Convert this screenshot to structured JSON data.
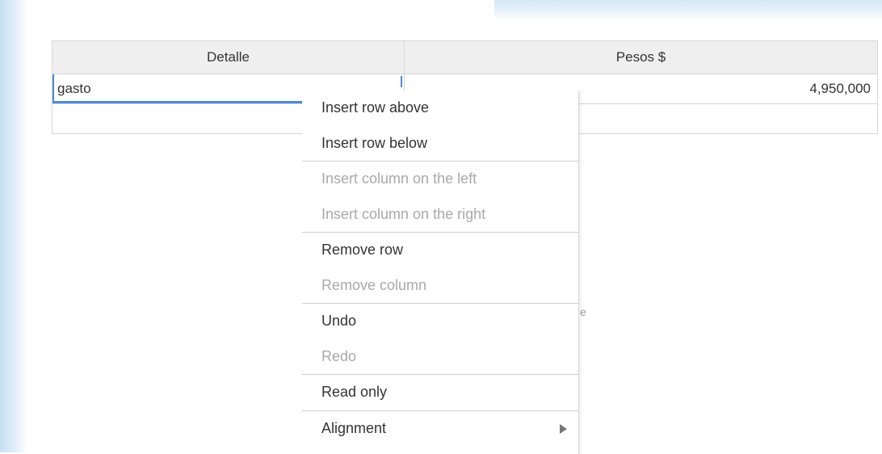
{
  "table": {
    "headers": [
      "Detalle",
      "Pesos $"
    ],
    "rows": [
      {
        "detalle": "gasto",
        "pesos": "4,950,000"
      },
      {
        "detalle": "",
        "pesos": ""
      }
    ]
  },
  "context_menu": {
    "items": [
      {
        "label": "Insert row above",
        "enabled": true
      },
      {
        "label": "Insert row below",
        "enabled": true
      },
      {
        "label": "Insert column on the left",
        "enabled": false
      },
      {
        "label": "Insert column on the right",
        "enabled": false
      },
      {
        "label": "Remove row",
        "enabled": true
      },
      {
        "label": "Remove column",
        "enabled": false
      },
      {
        "label": "Undo",
        "enabled": true
      },
      {
        "label": "Redo",
        "enabled": false
      },
      {
        "label": "Read only",
        "enabled": true
      },
      {
        "label": "Alignment",
        "enabled": true,
        "has_submenu": true
      }
    ]
  },
  "stray_text": "e",
  "colors": {
    "selection": "#4b89dc",
    "header_bg": "#efefef",
    "disabled_text": "#a9a9a9"
  }
}
